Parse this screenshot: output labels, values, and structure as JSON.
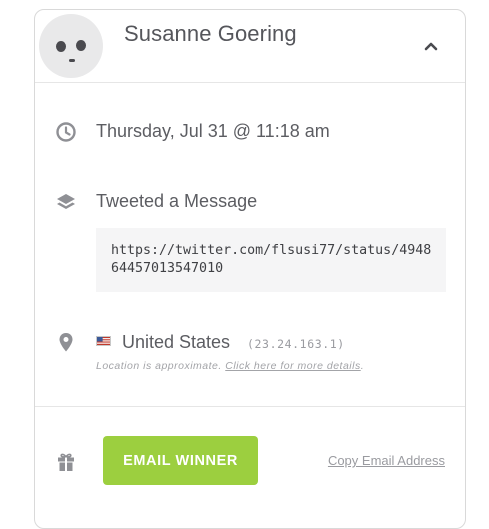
{
  "entrant": {
    "name": "Susanne Goering"
  },
  "entry": {
    "datetime": "Thursday, Jul 31 @ 11:18 am",
    "action": "Tweeted a Message",
    "url": "https://twitter.com/flsusi77/status/494864457013547010"
  },
  "location": {
    "country": "United States",
    "ip": "(23.24.163.1)",
    "note_prefix": "Location is approximate.",
    "note_link": "Click here for more details",
    "note_suffix": "."
  },
  "actions": {
    "email_button": "EMAIL WINNER",
    "copy_email_link": "Copy Email Address"
  },
  "icons": {
    "collapse": "chevron-up-icon",
    "date": "clock-icon",
    "action": "layers-icon",
    "location": "map-pin-icon",
    "prize": "gift-icon",
    "flag": "us-flag-icon"
  },
  "colors": {
    "accent_green": "#9ccf3f",
    "text": "#5c5d62",
    "muted": "#9a9ba0",
    "icon": "#8f9095"
  }
}
